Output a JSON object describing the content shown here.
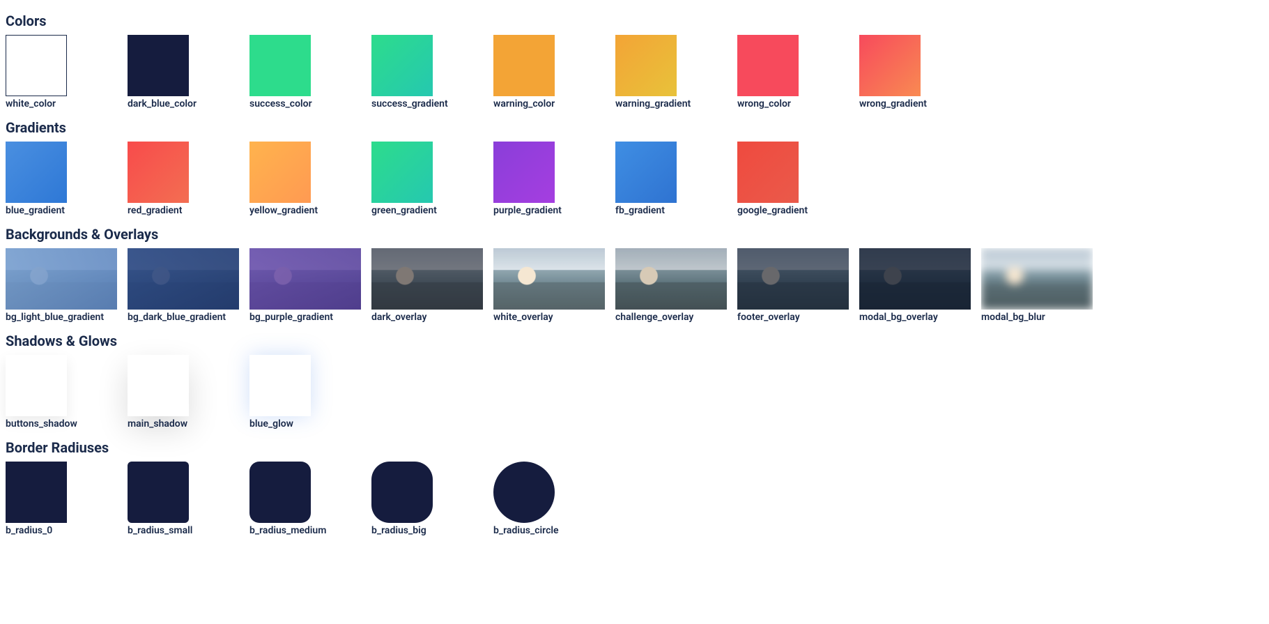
{
  "sections": {
    "colors": {
      "title": "Colors"
    },
    "gradients": {
      "title": "Gradients"
    },
    "backgrounds": {
      "title": "Backgrounds & Overlays"
    },
    "shadows": {
      "title": "Shadows & Glows"
    },
    "radiuses": {
      "title": "Border Radiuses"
    }
  },
  "colors": [
    {
      "name": "white_color",
      "fill": "#ffffff",
      "outline": true
    },
    {
      "name": "dark_blue_color",
      "fill": "#151c3e"
    },
    {
      "name": "success_color",
      "fill": "#2ddc8c"
    },
    {
      "name": "success_gradient",
      "fill": "linear-gradient(135deg,#2ddc8c,#25c8b0)"
    },
    {
      "name": "warning_color",
      "fill": "#f3a436"
    },
    {
      "name": "warning_gradient",
      "fill": "linear-gradient(135deg,#f3a436,#e8c23a)"
    },
    {
      "name": "wrong_color",
      "fill": "#f74a5c"
    },
    {
      "name": "wrong_gradient",
      "fill": "linear-gradient(135deg,#f74a5c,#f98a52)"
    }
  ],
  "gradients": [
    {
      "name": "blue_gradient",
      "fill": "linear-gradient(135deg,#4a8fe0,#2e78d6)"
    },
    {
      "name": "red_gradient",
      "fill": "linear-gradient(135deg,#f84b4b,#f36e52)"
    },
    {
      "name": "yellow_gradient",
      "fill": "linear-gradient(135deg,#ffb34d,#ff9a52)"
    },
    {
      "name": "green_gradient",
      "fill": "linear-gradient(135deg,#2ddc8c,#25c8b0)"
    },
    {
      "name": "purple_gradient",
      "fill": "linear-gradient(135deg,#8a3ed9,#a53ee0)"
    },
    {
      "name": "fb_gradient",
      "fill": "linear-gradient(135deg,#3f8ee3,#2f73d1)"
    },
    {
      "name": "google_gradient",
      "fill": "linear-gradient(135deg,#ef4a3f,#ea5a4a)"
    }
  ],
  "backgrounds": [
    {
      "name": "bg_light_blue_gradient",
      "overlay": "linear-gradient(135deg, rgba(120,160,210,0.85), rgba(90,130,190,0.85))",
      "blur": false
    },
    {
      "name": "bg_dark_blue_gradient",
      "overlay": "linear-gradient(135deg, rgba(40,70,130,0.88), rgba(30,55,110,0.88))",
      "blur": false
    },
    {
      "name": "bg_purple_gradient",
      "overlay": "linear-gradient(135deg, rgba(100,70,170,0.82), rgba(80,55,150,0.82))",
      "blur": false
    },
    {
      "name": "dark_overlay",
      "overlay": "rgba(30,30,40,0.55)",
      "blur": false
    },
    {
      "name": "white_overlay",
      "overlay": "rgba(255,255,255,0.05)",
      "blur": false
    },
    {
      "name": "challenge_overlay",
      "overlay": "rgba(0,0,0,0.12)",
      "blur": false
    },
    {
      "name": "footer_overlay",
      "overlay": "rgba(10,20,40,0.60)",
      "blur": false
    },
    {
      "name": "modal_bg_overlay",
      "overlay": "rgba(10,20,40,0.78)",
      "blur": false
    },
    {
      "name": "modal_bg_blur",
      "overlay": "rgba(255,255,255,0.0)",
      "blur": true
    }
  ],
  "shadows": [
    {
      "name": "buttons_shadow",
      "shadow": "0 8px 18px rgba(0,0,0,0.08)"
    },
    {
      "name": "main_shadow",
      "shadow": "0 18px 45px rgba(0,0,0,0.14)"
    },
    {
      "name": "blue_glow",
      "shadow": "0 0 28px rgba(70,130,230,0.25)"
    }
  ],
  "radiuses": [
    {
      "name": "b_radius_0",
      "radius": "0px"
    },
    {
      "name": "b_radius_small",
      "radius": "6px"
    },
    {
      "name": "b_radius_medium",
      "radius": "14px"
    },
    {
      "name": "b_radius_big",
      "radius": "26px"
    },
    {
      "name": "b_radius_circle",
      "radius": "50%"
    }
  ]
}
